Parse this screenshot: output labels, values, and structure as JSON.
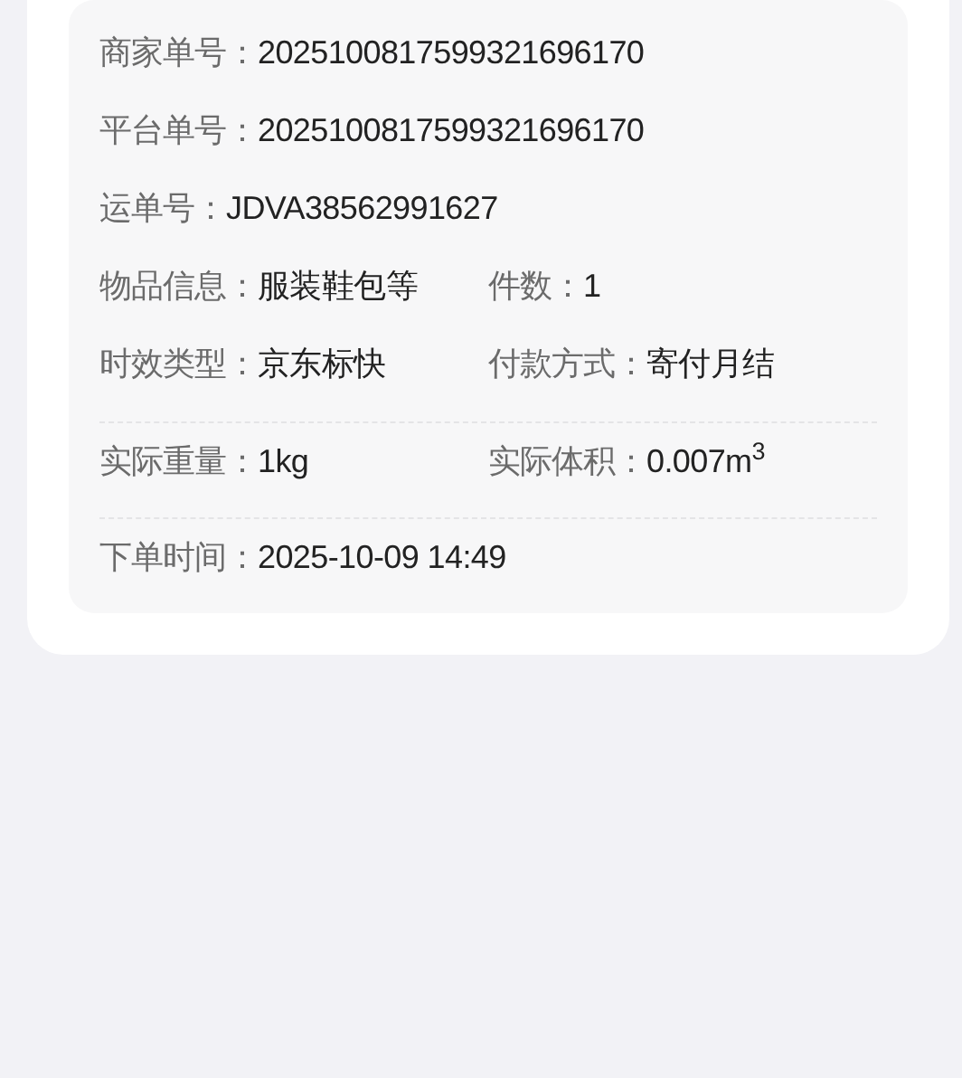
{
  "order_details": {
    "sections": [
      {
        "rows": [
          {
            "fields": [
              {
                "label": "商家单号：",
                "value": "2025100817599321696170",
                "kind": "text"
              }
            ]
          },
          {
            "fields": [
              {
                "label": "平台单号：",
                "value": "2025100817599321696170",
                "kind": "text"
              }
            ]
          },
          {
            "fields": [
              {
                "label": "运单号：",
                "value": "JDVA38562991627",
                "kind": "copyable"
              }
            ]
          },
          {
            "fields": [
              {
                "label": "物品信息：",
                "value": "服装鞋包等",
                "kind": "text"
              },
              {
                "label": "件数：",
                "value": "1",
                "kind": "text"
              }
            ]
          },
          {
            "fields": [
              {
                "label": "时效类型：",
                "value": "京东标快",
                "kind": "text"
              },
              {
                "label": "付款方式：",
                "value": "寄付月结",
                "kind": "text"
              }
            ]
          }
        ]
      },
      {
        "rows": [
          {
            "fields": [
              {
                "label": "实际重量：",
                "value": "1kg",
                "kind": "text"
              },
              {
                "label": "实际体积：",
                "value": "0.007m$^{3}$",
                "kind": "text"
              }
            ]
          }
        ]
      },
      {
        "rows": [
          {
            "fields": [
              {
                "label": "下单时间：",
                "value": "2025-10-09 14:49",
                "kind": "text"
              }
            ]
          }
        ]
      }
    ]
  }
}
